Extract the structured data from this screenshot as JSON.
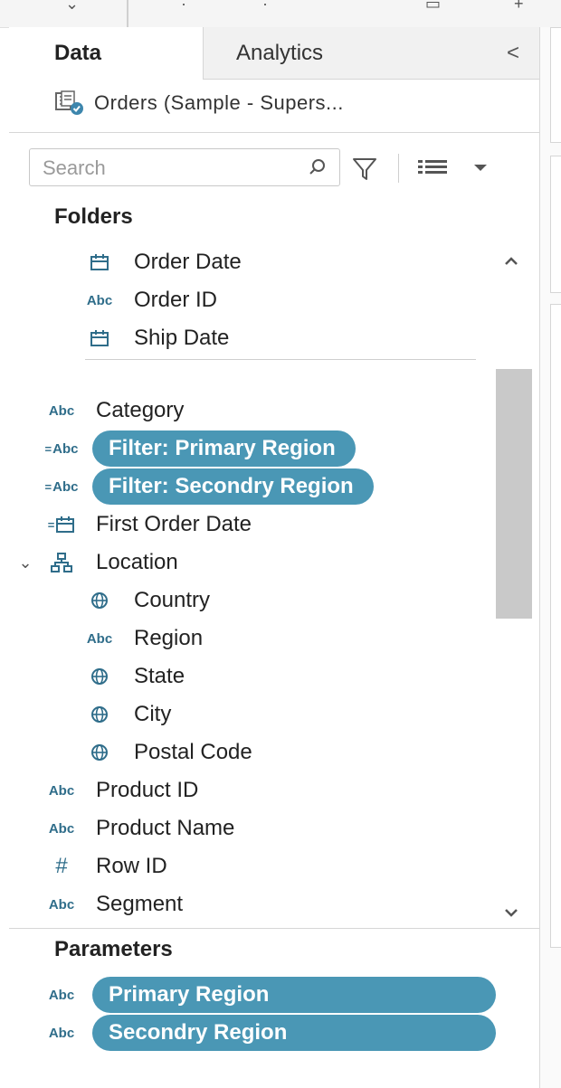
{
  "tabs": {
    "data": "Data",
    "analytics": "Analytics",
    "collapse": "<"
  },
  "datasource": {
    "name": "Orders (Sample - Supers..."
  },
  "search": {
    "placeholder": "Search"
  },
  "sections": {
    "folders": "Folders",
    "parameters": "Parameters"
  },
  "folder_fields": [
    {
      "label": "Order Date",
      "type": "date"
    },
    {
      "label": "Order ID",
      "type": "Abc"
    },
    {
      "label": "Ship Date",
      "type": "date"
    }
  ],
  "fields": [
    {
      "label": "Category",
      "type": "Abc"
    },
    {
      "label": "Filter: Primary Region",
      "type": "=Abc",
      "selected": true
    },
    {
      "label": "Filter: Secondry Region",
      "type": "=Abc",
      "selected": true
    },
    {
      "label": "First Order Date",
      "type": "=date"
    },
    {
      "label": "Location",
      "type": "hierarchy"
    },
    {
      "label": "Country",
      "type": "geo"
    },
    {
      "label": "Region",
      "type": "Abc"
    },
    {
      "label": "State",
      "type": "geo"
    },
    {
      "label": "City",
      "type": "geo"
    },
    {
      "label": "Postal Code",
      "type": "geo"
    },
    {
      "label": "Product ID",
      "type": "Abc"
    },
    {
      "label": "Product Name",
      "type": "Abc"
    },
    {
      "label": "Row ID",
      "type": "#"
    },
    {
      "label": "Segment",
      "type": "Abc"
    }
  ],
  "parameters": [
    {
      "label": "Primary Region",
      "type": "Abc"
    },
    {
      "label": "Secondry Region",
      "type": "Abc"
    }
  ],
  "icons": {
    "abc_text": "Abc",
    "calc_prefix": "=",
    "number": "#",
    "expand": "⌄"
  },
  "colors": {
    "pill": "#4a97b5",
    "type_icon": "#2f6d8a"
  }
}
